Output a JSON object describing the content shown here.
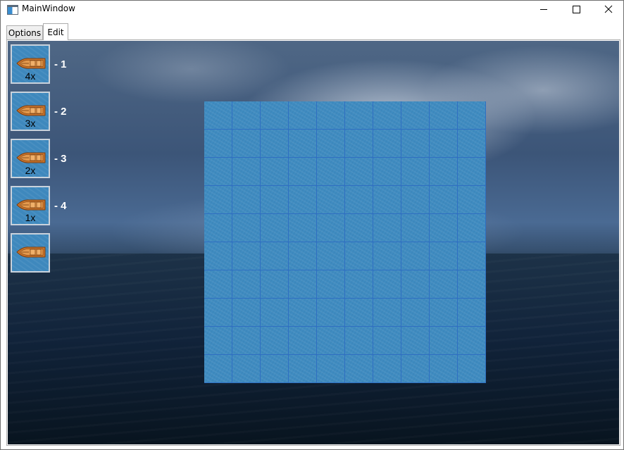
{
  "window": {
    "title": "MainWindow",
    "icons": [
      "app-icon",
      "minimize-icon",
      "maximize-icon",
      "close-icon"
    ]
  },
  "tabs": [
    {
      "label": "Options",
      "selected": false
    },
    {
      "label": "Edit",
      "selected": true
    }
  ],
  "palette": {
    "items": [
      {
        "count": "4x",
        "label": "- 1"
      },
      {
        "count": "3x",
        "label": "- 2"
      },
      {
        "count": "2x",
        "label": "- 3"
      },
      {
        "count": "1x",
        "label": "- 4"
      },
      {
        "count": "",
        "label": ""
      }
    ],
    "icon": "boat-icon"
  },
  "board": {
    "rows": 10,
    "columns": 10,
    "cell_color": "#3f8bc0",
    "grid_line_color": "#2f6fc2"
  },
  "colors": {
    "label_text": "#ffffff",
    "tile_border": "#c9d2dc"
  }
}
